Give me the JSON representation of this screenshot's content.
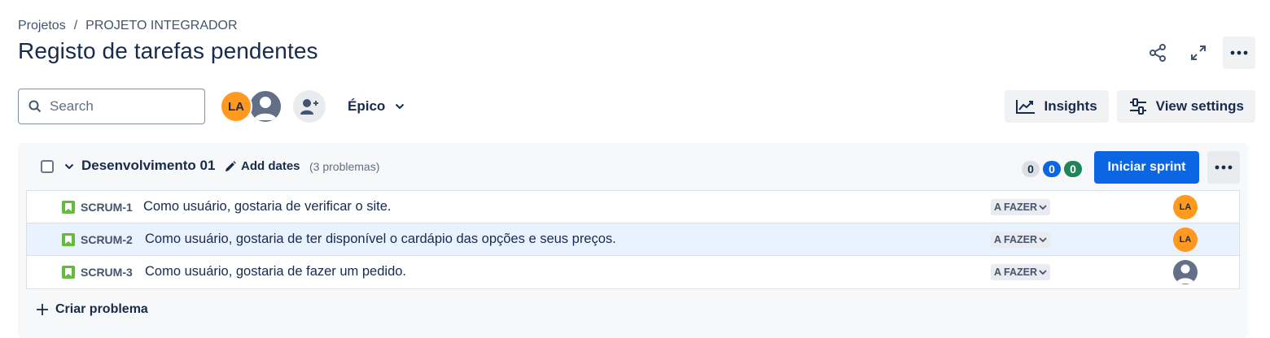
{
  "breadcrumb": {
    "project": "Projetos",
    "separator": "/",
    "current": "PROJETO INTEGRADOR"
  },
  "page": {
    "title": "Registo de tarefas pendentes"
  },
  "toolbar": {
    "search_placeholder": "Search",
    "avatar_initials": "LA",
    "epic_label": "Épico",
    "insights_label": "Insights",
    "view_settings_label": "View settings"
  },
  "sprint": {
    "name": "Desenvolvimento 01",
    "add_dates_label": "Add dates",
    "issue_count": "(3 problemas)",
    "badges": {
      "todo": "0",
      "in_progress": "0",
      "done": "0"
    },
    "start_button": "Iniciar sprint",
    "create_issue_label": "Criar problema",
    "issues": [
      {
        "key": "SCRUM-1",
        "summary": "Como usuário, gostaria de verificar o site.",
        "status": "A FAZER",
        "assignee": "LA"
      },
      {
        "key": "SCRUM-2",
        "summary": "Como usuário, gostaria de ter disponível o cardápio das opções e seus preços.",
        "status": "A FAZER",
        "assignee": "LA"
      },
      {
        "key": "SCRUM-3",
        "summary": "Como usuário, gostaria de fazer um pedido.",
        "status": "A FAZER",
        "assignee": ""
      }
    ]
  },
  "colors": {
    "primary": "#0c66e4",
    "avatar_orange": "#ff991f",
    "story_green": "#63ba3c",
    "badge_green": "#1f845a",
    "selected_row": "#e9f2ff"
  },
  "icons": [
    "search-icon",
    "share-icon",
    "expand-icon",
    "more-icon",
    "add-person-icon",
    "chevron-down-icon",
    "insights-icon",
    "settings-sliders-icon",
    "pencil-icon",
    "story-icon",
    "plus-icon",
    "user-icon"
  ]
}
